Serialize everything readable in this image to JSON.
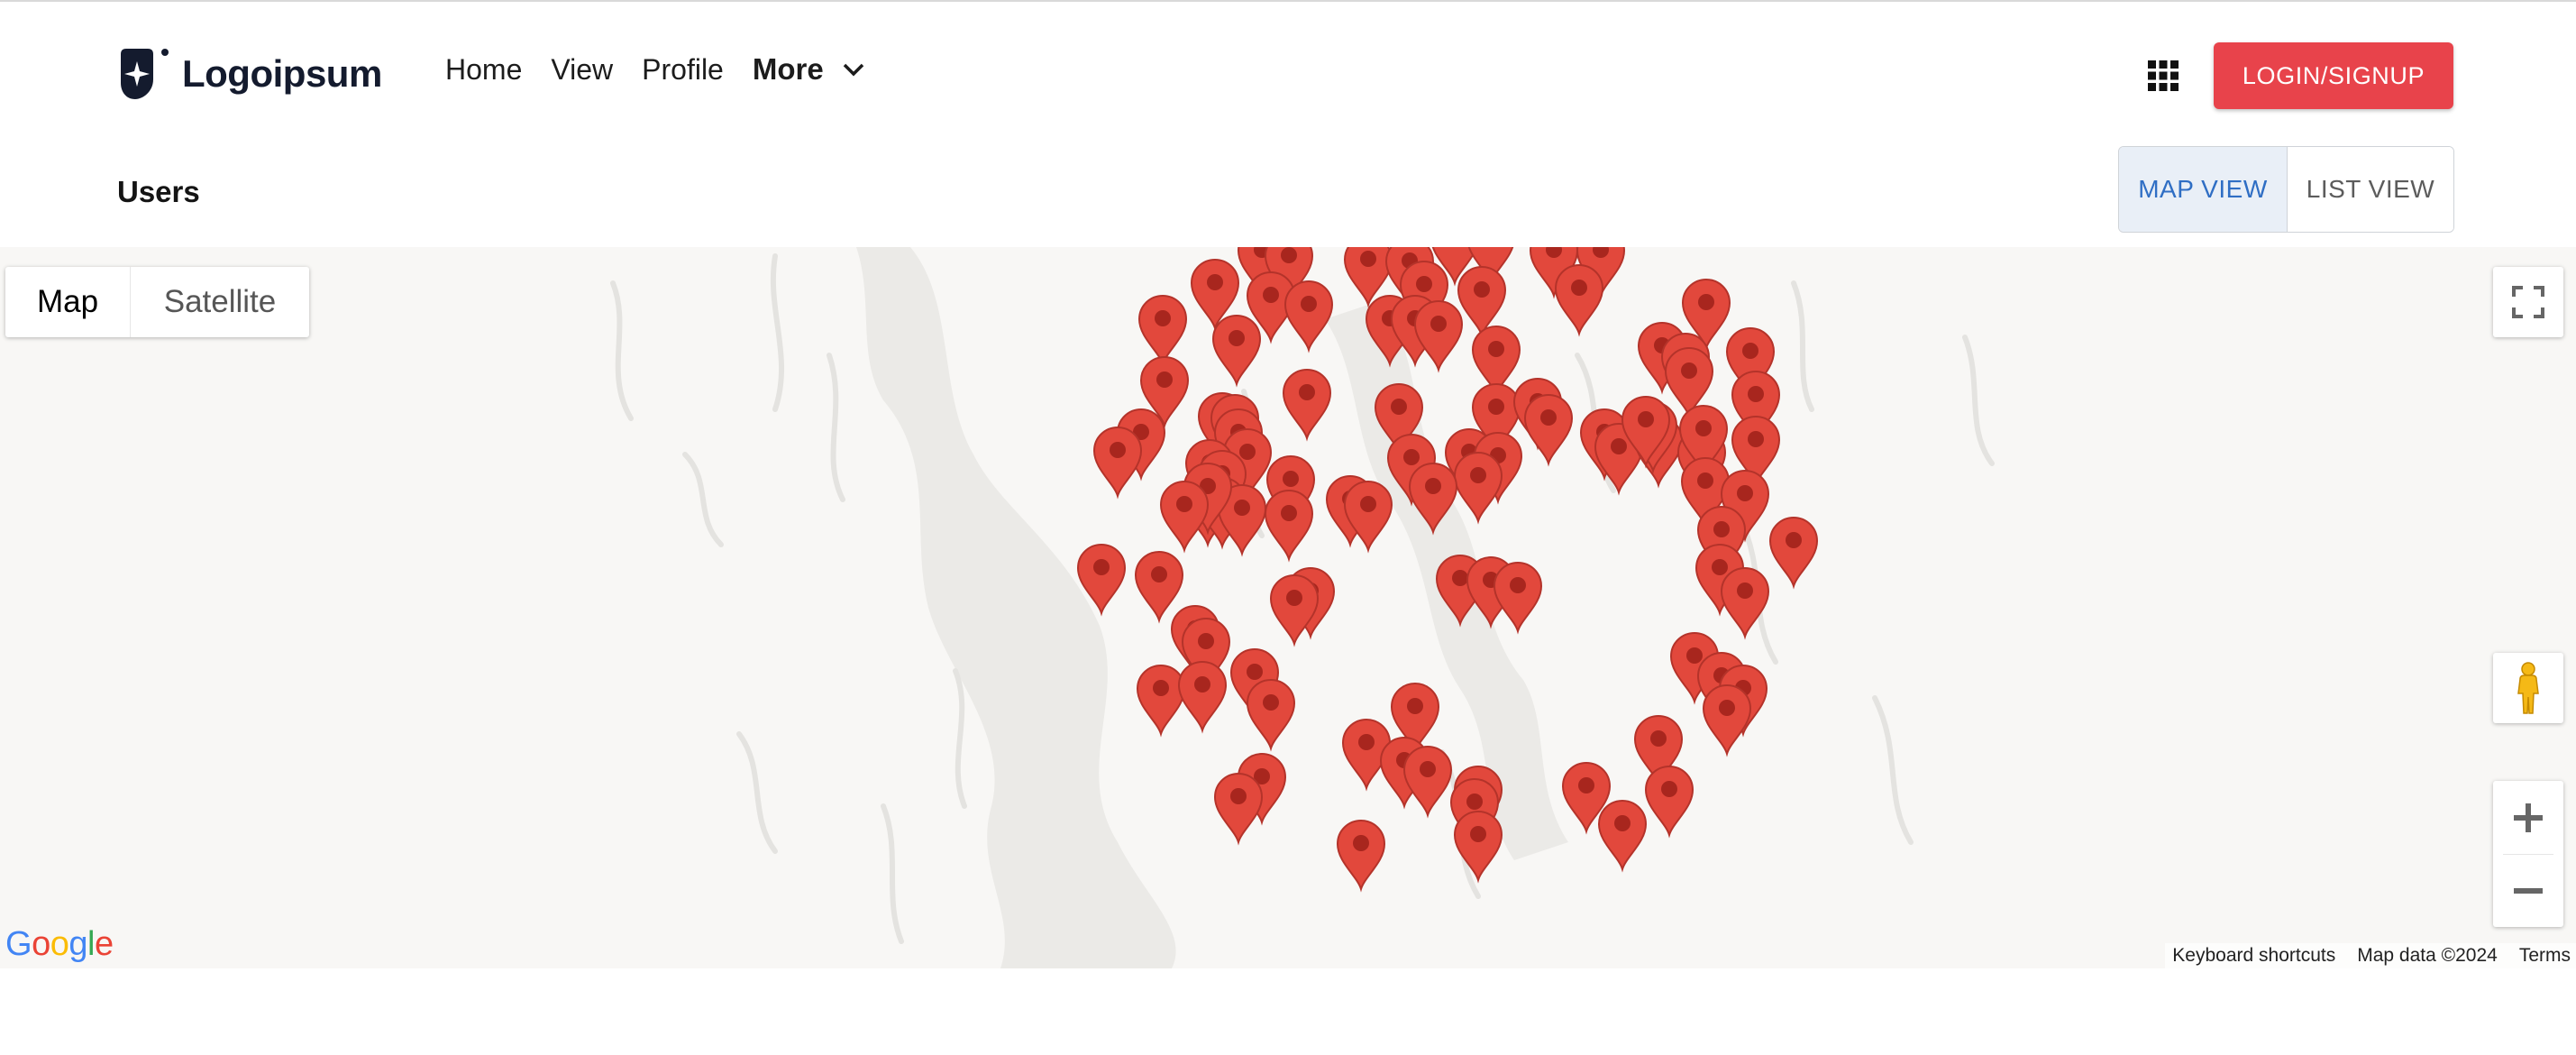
{
  "header": {
    "logo_text": "Logoipsum",
    "nav": [
      {
        "label": "Home"
      },
      {
        "label": "View"
      },
      {
        "label": "Profile"
      }
    ],
    "more_label": "More",
    "apps_icon": "grid-icon",
    "login_label": "LOGIN/SIGNUP",
    "login_color": "#e8434b"
  },
  "page": {
    "title": "Users",
    "view_toggle": {
      "map_label": "MAP VIEW",
      "list_label": "LIST VIEW",
      "selected": "map"
    }
  },
  "map": {
    "type_map_label": "Map",
    "type_satellite_label": "Satellite",
    "selected_type": "map",
    "google_logo": "Google",
    "attribution": {
      "shortcuts": "Keyboard shortcuts",
      "map_data": "Map data ©2024",
      "terms": "Terms"
    },
    "marker_color": "#e2483c",
    "marker_icon": "map-pin-icon",
    "controls": [
      "fullscreen-icon",
      "pegman-icon",
      "zoom-in-icon",
      "zoom-out-icon"
    ]
  }
}
